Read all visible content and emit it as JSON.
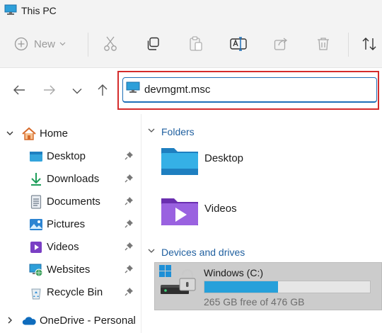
{
  "window": {
    "title": "This PC"
  },
  "toolbar": {
    "new_label": "New",
    "icons": [
      "add-icon",
      "cut-icon",
      "copy-icon",
      "paste-icon",
      "rename-icon",
      "share-icon",
      "delete-icon",
      "sort-icon"
    ]
  },
  "address_bar": {
    "value": "devmgmt.msc",
    "icon": "computer-icon"
  },
  "sidebar": {
    "items": [
      {
        "label": "Home",
        "icon": "home-icon",
        "expandable": true,
        "pinned": false
      },
      {
        "label": "Desktop",
        "icon": "desktop-folder-icon",
        "pinned": true
      },
      {
        "label": "Downloads",
        "icon": "download-icon",
        "pinned": true
      },
      {
        "label": "Documents",
        "icon": "document-icon",
        "pinned": true
      },
      {
        "label": "Pictures",
        "icon": "pictures-icon",
        "pinned": true
      },
      {
        "label": "Videos",
        "icon": "videos-icon",
        "pinned": true
      },
      {
        "label": "Websites",
        "icon": "websites-icon",
        "pinned": true
      },
      {
        "label": "Recycle Bin",
        "icon": "recycle-bin-icon",
        "pinned": true
      },
      {
        "label": "OneDrive - Personal",
        "icon": "onedrive-cloud-icon",
        "expandable": true,
        "pinned": false
      }
    ]
  },
  "content": {
    "folders_header": "Folders",
    "folders": [
      {
        "name": "Desktop",
        "icon": "desktop-folder-icon"
      },
      {
        "name": "Videos",
        "icon": "videos-folder-icon"
      }
    ],
    "drives_header": "Devices and drives",
    "drives": [
      {
        "name": "Windows (C:)",
        "free_text": "265 GB free of 476 GB",
        "used_fraction": 0.443,
        "icon": "locked-drive-icon"
      }
    ]
  },
  "colors": {
    "accent": "#1f6fb7",
    "highlight_border": "#d42c2c",
    "drive_bar_fill": "#26a0da",
    "group_header": "#1f5f9f",
    "selected_drive_bg": "#cccccc"
  }
}
